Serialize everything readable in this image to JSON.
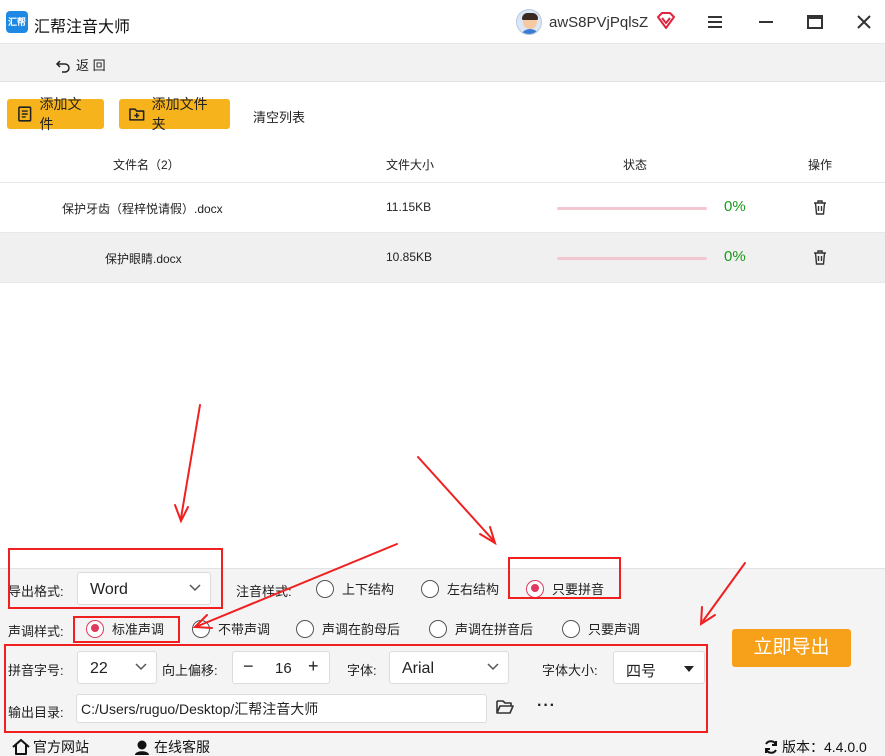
{
  "app": {
    "title": "汇帮注音大师",
    "logo_text": "汇帮",
    "username": "awS8PVjPqlsZ"
  },
  "icons": {
    "logo": "app-logo-icon",
    "avatar": "user-avatar",
    "vip": "vip-diamond-icon",
    "menu": "hamburger-menu-icon",
    "minimize": "minimize-icon",
    "maximize": "maximize-icon",
    "close": "close-icon",
    "back": "back-arrow-icon",
    "add_file": "add-file-icon",
    "add_folder": "add-folder-icon",
    "trash": "trash-icon",
    "folder": "folder-open-icon",
    "home": "home-icon",
    "support": "headset-icon",
    "refresh": "refresh-icon"
  },
  "colors": {
    "accent": "#f6b31b",
    "export": "#f7a11b",
    "radio_active": "#e03a5e",
    "progress_track": "#f3c7d2",
    "percent_text": "#1a9a1a",
    "annotation": "#f02020"
  },
  "nav": {
    "back_label": "返 回"
  },
  "toolbar": {
    "add_file": "添加文件",
    "add_folder": "添加文件夹",
    "clear_list": "清空列表"
  },
  "table": {
    "headers": {
      "name": "文件名（2）",
      "size": "文件大小",
      "status": "状态",
      "action": "操作"
    },
    "rows": [
      {
        "name": "保护牙齿（程梓悦请假）.docx",
        "size": "11.15KB",
        "progress": 0,
        "percent": "0%"
      },
      {
        "name": "保护眼睛.docx",
        "size": "10.85KB",
        "progress": 0,
        "percent": "0%"
      }
    ]
  },
  "settings": {
    "export_format_label": "导出格式:",
    "export_format_value": "Word",
    "annotation_style_label": "注音样式:",
    "annotation_styles": [
      {
        "label": "上下结构",
        "selected": false
      },
      {
        "label": "左右结构",
        "selected": false
      },
      {
        "label": "只要拼音",
        "selected": true
      }
    ],
    "tone_style_label": "声调样式:",
    "tone_styles": [
      {
        "label": "标准声调",
        "selected": true
      },
      {
        "label": "不带声调",
        "selected": false
      },
      {
        "label": "声调在韵母后",
        "selected": false
      },
      {
        "label": "声调在拼音后",
        "selected": false
      },
      {
        "label": "只要声调",
        "selected": false
      }
    ],
    "pinyin_size_label": "拼音字号:",
    "pinyin_size_value": "22",
    "offset_label": "向上偏移:",
    "offset_value": "16",
    "offset_minus": "−",
    "offset_plus": "+",
    "font_label": "字体:",
    "font_value": "Arial",
    "font_size_label": "字体大小:",
    "font_size_value": "四号",
    "output_dir_label": "输出目录:",
    "output_dir_value": "C:/Users/ruguo/Desktop/汇帮注音大师",
    "more_label": "···",
    "export_button": "立即导出"
  },
  "footer": {
    "website": "官方网站",
    "support": "在线客服",
    "version": "版本：4.4.0.0"
  }
}
